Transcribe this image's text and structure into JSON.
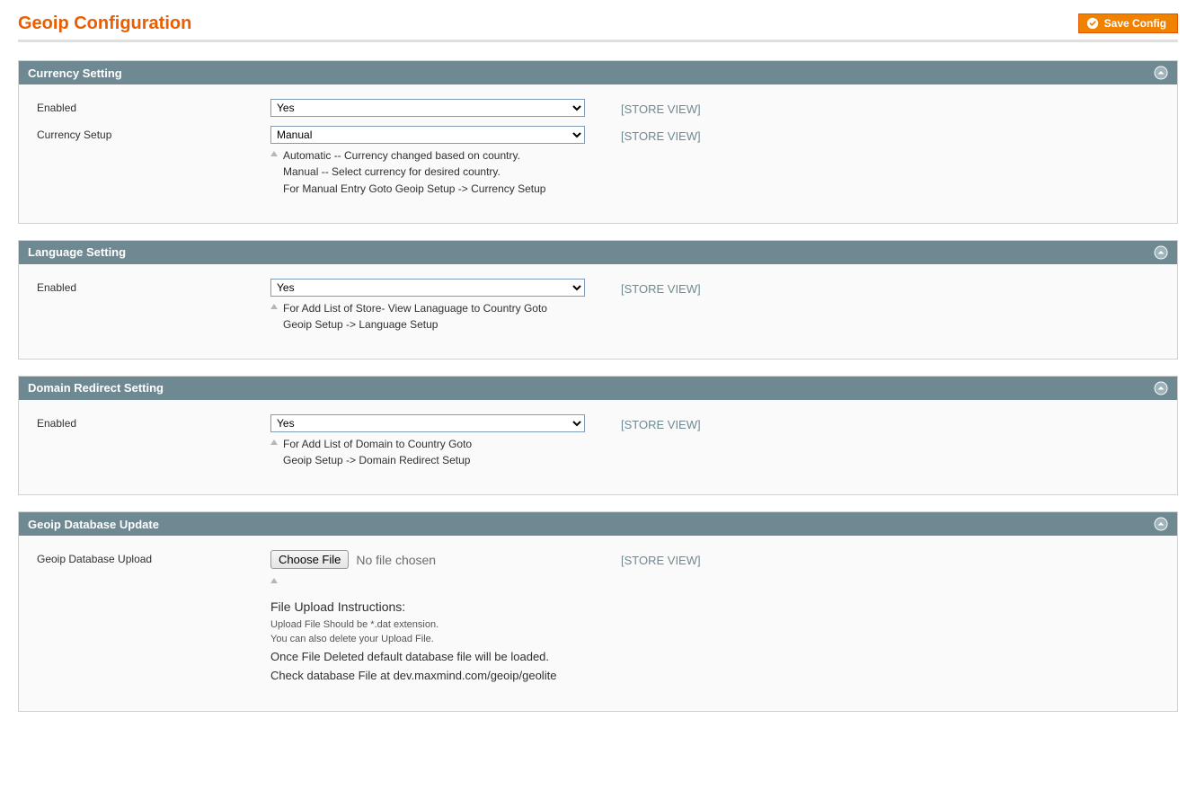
{
  "page": {
    "title": "Geoip Configuration",
    "save_label": "Save Config"
  },
  "scope_label": "[STORE VIEW]",
  "sections": {
    "currency": {
      "title": "Currency Setting",
      "enabled_label": "Enabled",
      "enabled_value": "Yes",
      "setup_label": "Currency Setup",
      "setup_value": "Manual",
      "setup_note": "Automatic -- Currency changed based on country.\nManual   -- Select currency for desired country.\nFor Manual Entry Goto Geoip Setup -> Currency Setup"
    },
    "language": {
      "title": "Language Setting",
      "enabled_label": "Enabled",
      "enabled_value": "Yes",
      "enabled_note": "For Add List of Store- View Lanaguage to Country Goto\nGeoip Setup -> Language Setup"
    },
    "domain": {
      "title": "Domain Redirect Setting",
      "enabled_label": "Enabled",
      "enabled_value": "Yes",
      "enabled_note": "For Add List of Domain to Country Goto\nGeoip Setup -> Domain Redirect Setup"
    },
    "db": {
      "title": "Geoip Database Update",
      "upload_label": "Geoip Database Upload",
      "choose_file": "Choose File",
      "no_file": "No file chosen",
      "instr_title": "File Upload Instructions:",
      "instr_a": "Upload File Should be *.dat extension.",
      "instr_b": "You can also delete your Upload File.",
      "instr_c": "Once File Deleted default database file will be loaded.",
      "instr_d": "Check database File at dev.maxmind.com/geoip/geolite"
    }
  }
}
